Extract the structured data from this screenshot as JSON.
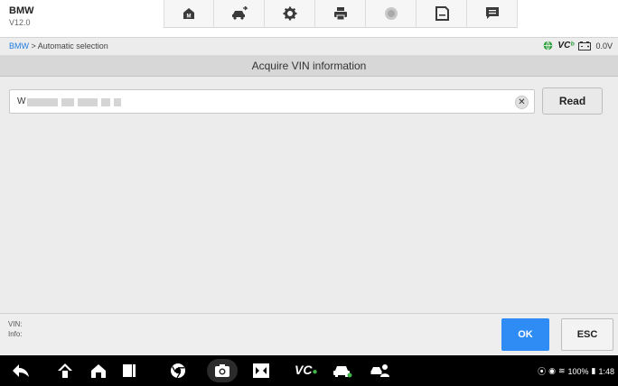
{
  "app": {
    "make": "BMW",
    "version": "V12.0"
  },
  "toolbar": {
    "buttons": [
      {
        "icon": "home-m-icon"
      },
      {
        "icon": "vehicle-swap-icon"
      },
      {
        "icon": "settings-gear-icon"
      },
      {
        "icon": "printer-icon"
      },
      {
        "icon": "help-icon"
      },
      {
        "icon": "save-icon"
      },
      {
        "icon": "message-icon"
      }
    ]
  },
  "breadcrumb": {
    "root": "BMW",
    "separator": " > ",
    "current": "Automatic selection"
  },
  "status": {
    "vci_logo": "VC",
    "voltage": "0.0V"
  },
  "screen_title": "Acquire VIN information",
  "vin": {
    "value_prefix": "W"
  },
  "buttons": {
    "read": "Read",
    "ok": "OK",
    "esc": "ESC"
  },
  "info": {
    "vin_label": "VIN:",
    "info_label": "Info:"
  },
  "navbar": {
    "vc_label": "VC",
    "battery": "100%",
    "time": "1:48"
  },
  "colors": {
    "accent": "#2f8cf5",
    "link": "#1e7de0",
    "vci_green": "#2e9e3a"
  }
}
